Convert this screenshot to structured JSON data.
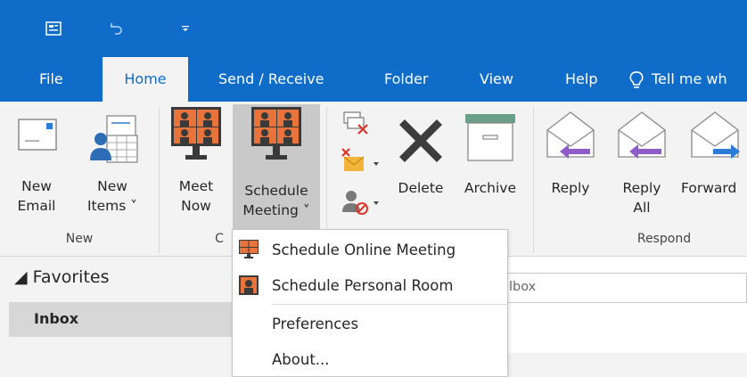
{
  "tabs": [
    {
      "label": "File"
    },
    {
      "label": "Home"
    },
    {
      "label": "Send / Receive"
    },
    {
      "label": "Folder"
    },
    {
      "label": "View"
    },
    {
      "label": "Help"
    },
    {
      "label": "Tell me wh"
    }
  ],
  "ribbon": {
    "new_email": {
      "line1": "New",
      "line2": "Email"
    },
    "new_items": {
      "line1": "New",
      "line2": "Items ˅"
    },
    "meet_now": {
      "line1": "Meet",
      "line2": "Now"
    },
    "schedule_meeting": {
      "line1": "Schedule",
      "line2": "Meeting ˅"
    },
    "delete": {
      "label": "Delete"
    },
    "archive": {
      "label": "Archive"
    },
    "reply": {
      "label": "Reply"
    },
    "reply_all": {
      "line1": "Reply",
      "line2": "All"
    },
    "forward": {
      "label": "Forward"
    },
    "groups": {
      "new": "New",
      "partial": "C",
      "respond": "Respond"
    }
  },
  "nav": {
    "favorites": "◢ Favorites",
    "inbox": "Inbox"
  },
  "search": {
    "placeholder": "lbox"
  },
  "menu": {
    "items": [
      {
        "label": "Schedule Online Meeting"
      },
      {
        "label": "Schedule Personal Room"
      },
      {
        "label": "Preferences"
      },
      {
        "label": "About..."
      }
    ]
  },
  "colors": {
    "accent_blue": "#0f6cc9",
    "ribbon_bg": "#f3f3f3",
    "meeting_orange": "#e8743b",
    "purple_arrow": "#8e5cc8",
    "forward_blue": "#2c7bd6"
  }
}
